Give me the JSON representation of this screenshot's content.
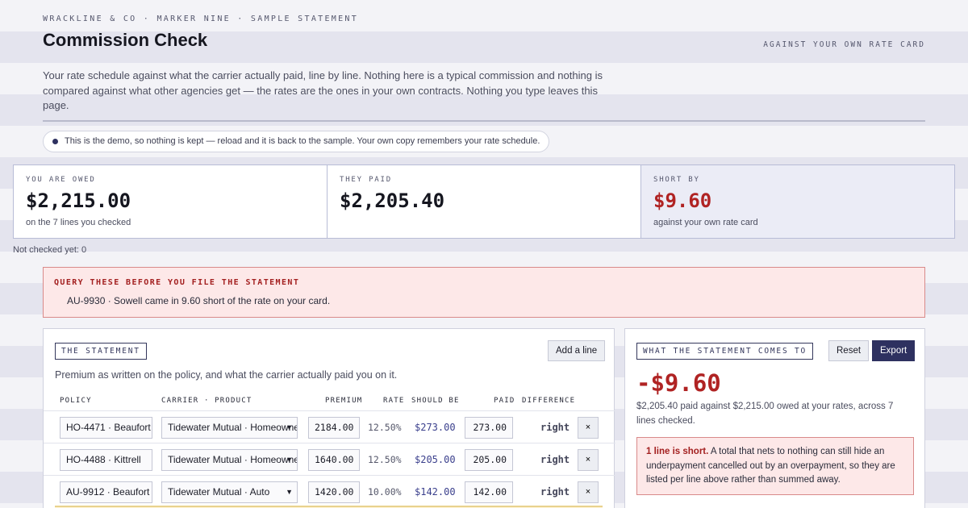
{
  "header": {
    "kicker": "WRACKLINE & CO · MARKER NINE · SAMPLE STATEMENT",
    "title": "Commission Check",
    "right_tag": "AGAINST YOUR OWN RATE CARD",
    "intro": "Your rate schedule against what the carrier actually paid, line by line. Nothing here is a typical commission and nothing is compared against what other agencies get — the rates are the ones in your own contracts. Nothing you type leaves this page.",
    "notice": "This is the demo, so nothing is kept — reload and it is back to the sample. Your own copy remembers your rate schedule."
  },
  "summary": {
    "owed": {
      "label": "YOU ARE OWED",
      "value": "$2,215.00",
      "note": "on the 7 lines you checked"
    },
    "paid": {
      "label": "THEY PAID",
      "value": "$2,205.40",
      "note": ""
    },
    "short": {
      "label": "SHORT BY",
      "value": "$9.60",
      "note": "against your own rate card"
    },
    "not_checked": "Not checked yet: 0"
  },
  "query": {
    "title": "QUERY THESE BEFORE YOU FILE THE STATEMENT",
    "items": [
      "AU-9930 · Sowell came in 9.60 short of the rate on your card."
    ]
  },
  "statement": {
    "tag": "THE STATEMENT",
    "add_label": "Add a line",
    "description": "Premium as written on the policy, and what the carrier actually paid you on it.",
    "columns": {
      "policy": "POLICY",
      "carrier": "CARRIER · PRODUCT",
      "premium": "PREMIUM",
      "rate": "RATE",
      "should": "SHOULD BE",
      "paid": "PAID",
      "difference": "DIFFERENCE"
    },
    "rows": [
      {
        "policy": "HO-4471 · Beaufort",
        "carrier": "Tidewater Mutual · Homeowners",
        "premium": "2184.00",
        "rate": "12.50%",
        "should": "$273.00",
        "paid": "273.00",
        "difference": "right",
        "remove": "×"
      },
      {
        "policy": "HO-4488 · Kittrell",
        "carrier": "Tidewater Mutual · Homeowners",
        "premium": "1640.00",
        "rate": "12.50%",
        "should": "$205.00",
        "paid": "205.00",
        "difference": "right",
        "remove": "×"
      },
      {
        "policy": "AU-9912 · Beaufort",
        "carrier": "Tidewater Mutual · Auto",
        "premium": "1420.00",
        "rate": "10.00%",
        "should": "$142.00",
        "paid": "142.00",
        "difference": "right",
        "remove": "×"
      }
    ]
  },
  "result": {
    "tag": "WHAT THE STATEMENT COMES TO",
    "reset_label": "Reset",
    "export_label": "Export",
    "value": "-$9.60",
    "description": "$2,205.40 paid against $2,215.00 owed at your rates, across 7 lines checked.",
    "warning_strong": "1 line is short.",
    "warning_text": " A total that nets to nothing can still hide an underpayment cancelled out by an overpayment, so they are listed per line above rather than summed away."
  },
  "icons": {
    "select_arrow": "chevron-down-icon",
    "notice_dot": "dot-icon"
  },
  "colors": {
    "accent": "#2e3160",
    "short": "#b02323",
    "alert_bg": "#fde8e8"
  }
}
